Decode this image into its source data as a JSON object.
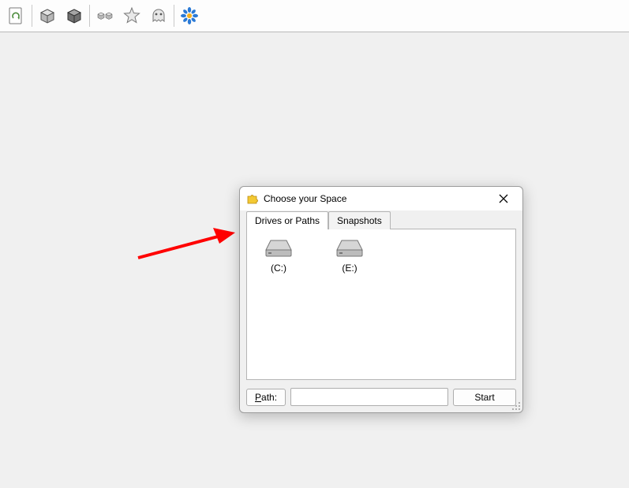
{
  "toolbar": {
    "icons": [
      "refresh",
      "cube",
      "cube-dark",
      "cubes-small",
      "star",
      "ghost",
      "gear-flower"
    ]
  },
  "dialog": {
    "title": "Choose your Space",
    "tabs": {
      "drives": "Drives or Paths",
      "snapshots": "Snapshots"
    },
    "drives": [
      {
        "label": "(C:)"
      },
      {
        "label": "(E:)"
      }
    ],
    "path_button": "Path:",
    "path_value": "",
    "start_button": "Start"
  }
}
